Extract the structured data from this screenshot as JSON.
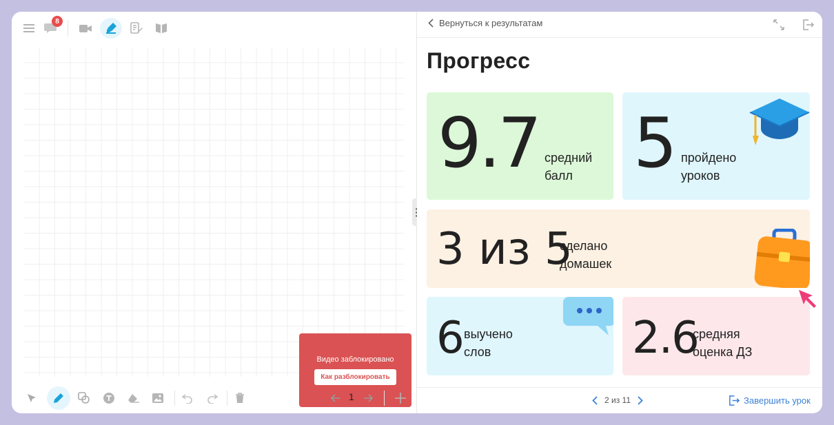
{
  "notifications": {
    "count": "8"
  },
  "board": {
    "video_blocked": "Видео заблокировано",
    "unlock_button": "Как разблокировать"
  },
  "pagination_left": {
    "current": "1"
  },
  "header": {
    "back_label": "Вернуться к результатам"
  },
  "page": {
    "title": "Прогресс"
  },
  "stats": {
    "avg_score": {
      "value": "9.7",
      "label_line1": "средний",
      "label_line2": "балл"
    },
    "lessons": {
      "value": "5",
      "label_line1": "пройдено",
      "label_line2": "уроков"
    },
    "homework": {
      "value": "3 из 5",
      "label_line1": "сделано",
      "label_line2": "домашек"
    },
    "words": {
      "value": "6",
      "label_line1": "выучено",
      "label_line2": "слов"
    },
    "hw_grade": {
      "value": "2.6",
      "label_line1": "средняя",
      "label_line2": "оценка ДЗ"
    }
  },
  "footer": {
    "pager": "2 из 11",
    "finish_label": "Завершить урок"
  },
  "colors": {
    "accent": "#1aa3d9",
    "green_card": "#dcf8d8",
    "blue_card": "#dff6fd",
    "orange_card": "#fdf1e3",
    "pink_card": "#fde7ea",
    "blocked": "#da5253",
    "link": "#3b82d6"
  }
}
